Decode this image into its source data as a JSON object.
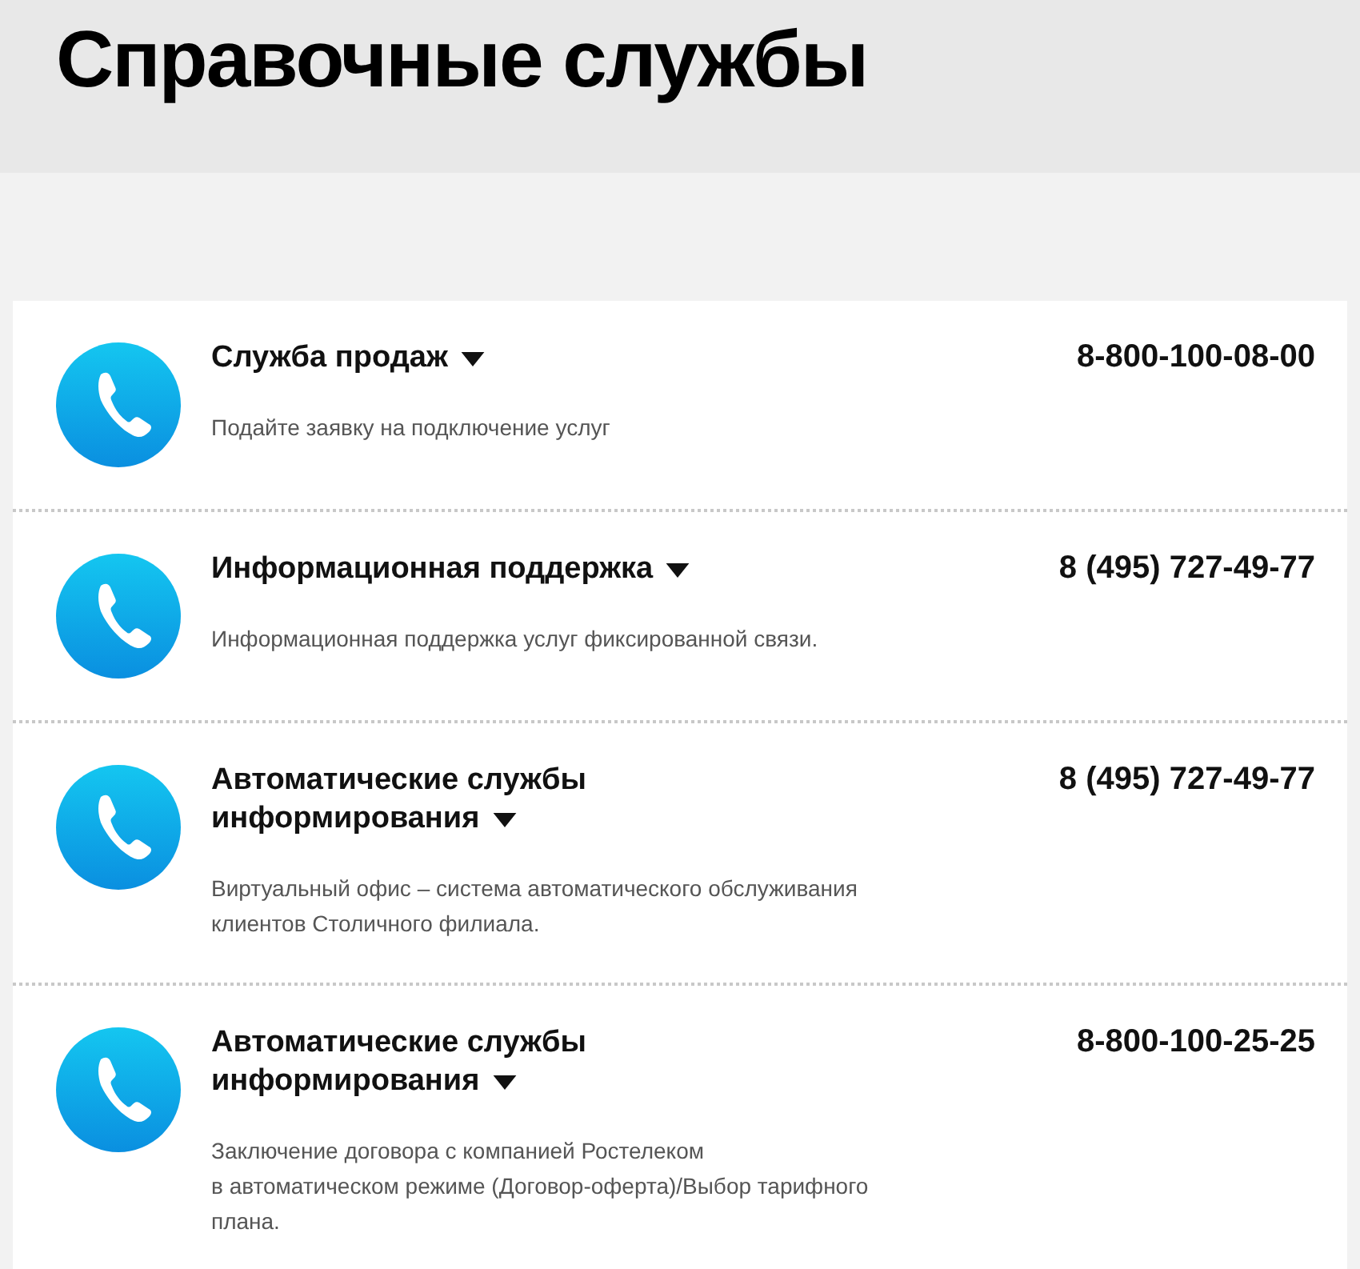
{
  "page_title": "Справочные службы",
  "services": [
    {
      "title_lines": [
        "Служба продаж"
      ],
      "phone": "8-800-100-08-00",
      "description_lines": [
        "Подайте заявку на подключение услуг"
      ]
    },
    {
      "title_lines": [
        "Информационная поддержка"
      ],
      "phone": "8 (495) 727-49-77",
      "description_lines": [
        "Информационная поддержка услуг фиксированной связи."
      ]
    },
    {
      "title_lines": [
        "Автоматические службы",
        "информирования"
      ],
      "phone": "8 (495) 727-49-77",
      "description_lines": [
        "Виртуальный офис – система автоматического обслуживания",
        "клиентов Столичного филиала."
      ]
    },
    {
      "title_lines": [
        "Автоматические службы",
        "информирования"
      ],
      "phone": "8-800-100-25-25",
      "description_lines": [
        "Заключение договора с компанией Ростелеком",
        "в автоматическом режиме (Договор-оферта)/Выбор тарифного",
        "плана."
      ]
    }
  ]
}
